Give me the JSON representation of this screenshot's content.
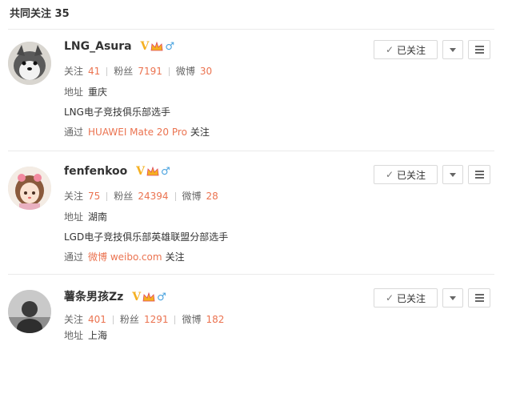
{
  "header": {
    "title": "共同关注 35"
  },
  "labels": {
    "follow": "关注",
    "fans": "粉丝",
    "weibo": "微博",
    "location": "地址",
    "via": "通过",
    "via_suffix": "关注",
    "followed_button": "已关注"
  },
  "users": [
    {
      "name": "LNG_Asura",
      "follow_count": "41",
      "fans_count": "7191",
      "weibo_count": "30",
      "location": "重庆",
      "bio": "LNG电子竞技俱乐部选手",
      "via_source": "HUAWEI Mate 20 Pro",
      "avatar_text": "哈士奇"
    },
    {
      "name": "fenfenkoo",
      "follow_count": "75",
      "fans_count": "24394",
      "weibo_count": "28",
      "location": "湖南",
      "bio": "LGD电子竞技俱乐部英雄联盟分部选手",
      "via_source": "微博 weibo.com"
    },
    {
      "name": "薯条男孩Zz",
      "follow_count": "401",
      "fans_count": "1291",
      "weibo_count": "182",
      "location": "上海"
    }
  ],
  "colors": {
    "accent": "#eb7350",
    "verify": "#f5b021",
    "male": "#4aa3df"
  },
  "icons": [
    "verified-v-icon",
    "crown-icon",
    "male-icon",
    "check-icon",
    "caret-down-icon",
    "menu-icon"
  ]
}
